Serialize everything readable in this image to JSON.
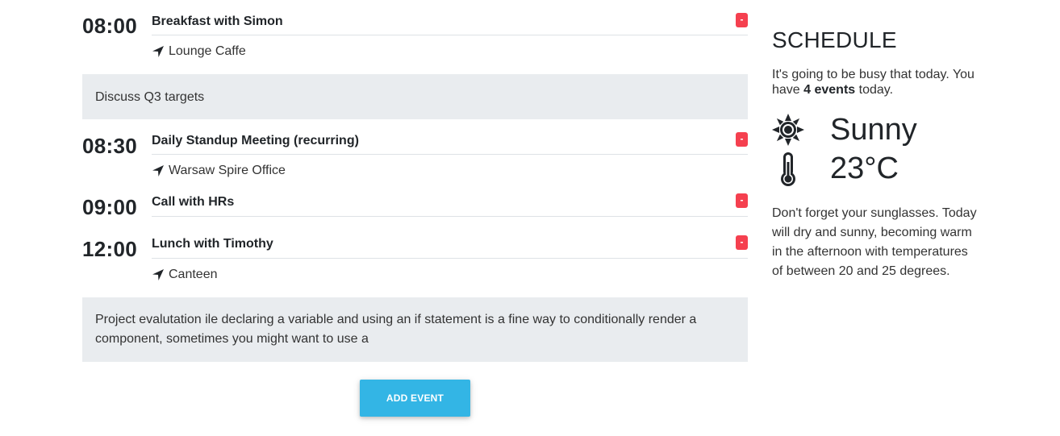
{
  "events": [
    {
      "time": "08:00",
      "title": "Breakfast with Simon",
      "location": "Lounge Caffe",
      "delete_label": "-",
      "note": "Discuss Q3 targets"
    },
    {
      "time": "08:30",
      "title": "Daily Standup Meeting (recurring)",
      "location": "Warsaw Spire Office",
      "delete_label": "-"
    },
    {
      "time": "09:00",
      "title": "Call with HRs",
      "delete_label": "-"
    },
    {
      "time": "12:00",
      "title": "Lunch with Timothy",
      "location": "Canteen",
      "delete_label": "-",
      "note": "Project evalutation ile declaring a variable and using an if statement is a fine way to conditionally render a component, sometimes you might want to use a"
    }
  ],
  "add_button_label": "ADD EVENT",
  "sidebar": {
    "title": "SCHEDULE",
    "desc_before": "It's going to be busy that today. You have ",
    "desc_bold": "4 events",
    "desc_after": " today.",
    "weather_condition": "Sunny",
    "temperature": "23°C",
    "forecast": "Don't forget your sunglasses. Today will dry and sunny, becoming warm in the afternoon with temperatures of between 20 and 25 degrees.",
    "weather_icon": "sun-icon",
    "thermometer_icon": "thermometer-icon"
  },
  "colors": {
    "accent": "#33b5e5",
    "delete": "#f5404f",
    "note_bg": "#e9ecef"
  }
}
